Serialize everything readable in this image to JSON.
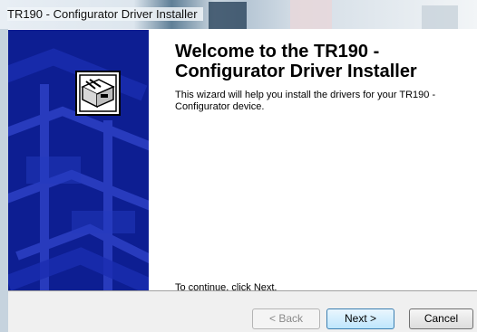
{
  "window": {
    "title": "TR190 - Configurator Driver Installer"
  },
  "main": {
    "heading": "Welcome to the TR190 - Configurator Driver Installer",
    "description": "This wizard will help you install the drivers for your TR190 - Configurator device.",
    "continue_hint": "To continue, click Next."
  },
  "buttons": {
    "back_label": "< Back",
    "next_label": "Next >",
    "cancel_label": "Cancel"
  },
  "colors": {
    "banner": "#0d1e92",
    "accent": "#3c7fb1"
  },
  "icons": {
    "installer_logo": "computer-drive-icon"
  }
}
